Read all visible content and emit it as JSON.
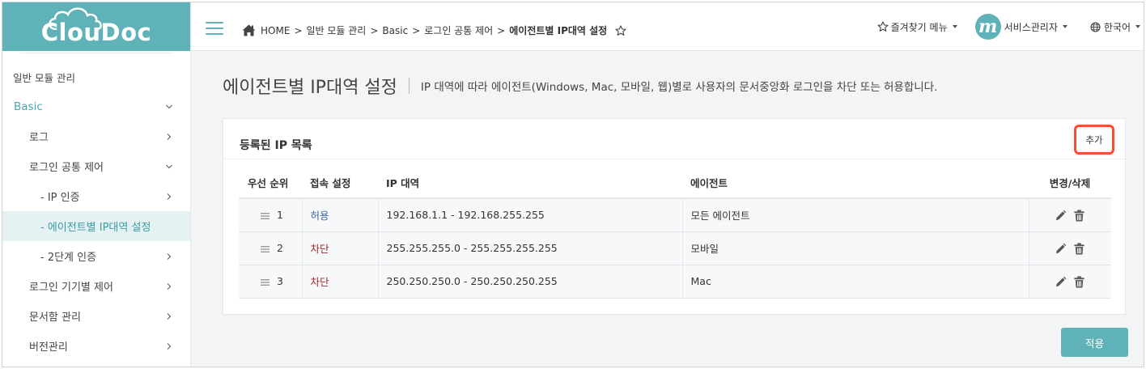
{
  "app": {
    "logo_text": "ClouDoc"
  },
  "sidebar": {
    "group_title": "일반 모듈 관리",
    "items": [
      {
        "label": "Basic",
        "level": 0,
        "chevron": "down"
      },
      {
        "label": "로그",
        "level": 1,
        "chevron": "right"
      },
      {
        "label": "로그인 공통 제어",
        "level": 1,
        "chevron": "down"
      },
      {
        "label": "- IP 인증",
        "level": 2,
        "chevron": "right"
      },
      {
        "label": "- 에이전트별 IP대역 설정",
        "level": 2,
        "chevron": "none",
        "active": true
      },
      {
        "label": "- 2단계 인증",
        "level": 2,
        "chevron": "right"
      },
      {
        "label": "로그인 기기별 제어",
        "level": 1,
        "chevron": "right"
      },
      {
        "label": "문서함 관리",
        "level": 1,
        "chevron": "right"
      },
      {
        "label": "버전관리",
        "level": 1,
        "chevron": "right"
      }
    ]
  },
  "header": {
    "breadcrumb": {
      "home": "HOME",
      "sep": ">",
      "crumb1": "일반 모듈 관리",
      "crumb2": "Basic",
      "crumb3": "로그인 공통 제어",
      "current": "에이전트별 IP대역 설정"
    },
    "favorites_label": "즐겨찾기 메뉴",
    "avatar_letter": "m",
    "user_label": "서비스관리자",
    "language_label": "한국어"
  },
  "main": {
    "title": "에이전트별 IP대역 설정",
    "description": "IP 대역에 따라 에이전트(Windows, Mac, 모바일, 웹)별로 사용자의 문서중앙화 로그인을 차단 또는 허용합니다.",
    "panel_title": "등록된 IP 목록",
    "add_label": "추가",
    "apply_label": "적용",
    "table": {
      "headers": {
        "priority": "우선 순위",
        "connection": "접속 설정",
        "ip_range": "IP 대역",
        "agent": "에이전트",
        "actions": "변경/삭제"
      },
      "rows": [
        {
          "priority": "1",
          "connection": "허용",
          "type": "allow",
          "ip_range": "192.168.1.1 - 192.168.255.255",
          "agent": "모든 에이전트"
        },
        {
          "priority": "2",
          "connection": "차단",
          "type": "block",
          "ip_range": "255.255.255.0 - 255.255.255.255",
          "agent": "모바일"
        },
        {
          "priority": "3",
          "connection": "차단",
          "type": "block",
          "ip_range": "250.250.250.0 - 250.250.250.255",
          "agent": "Mac"
        }
      ]
    }
  },
  "colors": {
    "brand": "#5fb3b8",
    "allow": "#3a64a8",
    "block": "#9a2a2a",
    "highlight": "#f0542e"
  },
  "icons": {
    "menu": "hamburger-icon",
    "home": "home-icon",
    "star": "star-icon",
    "globe": "globe-icon",
    "edit": "pencil-icon",
    "delete": "trash-icon",
    "drag": "drag-handle-icon"
  }
}
